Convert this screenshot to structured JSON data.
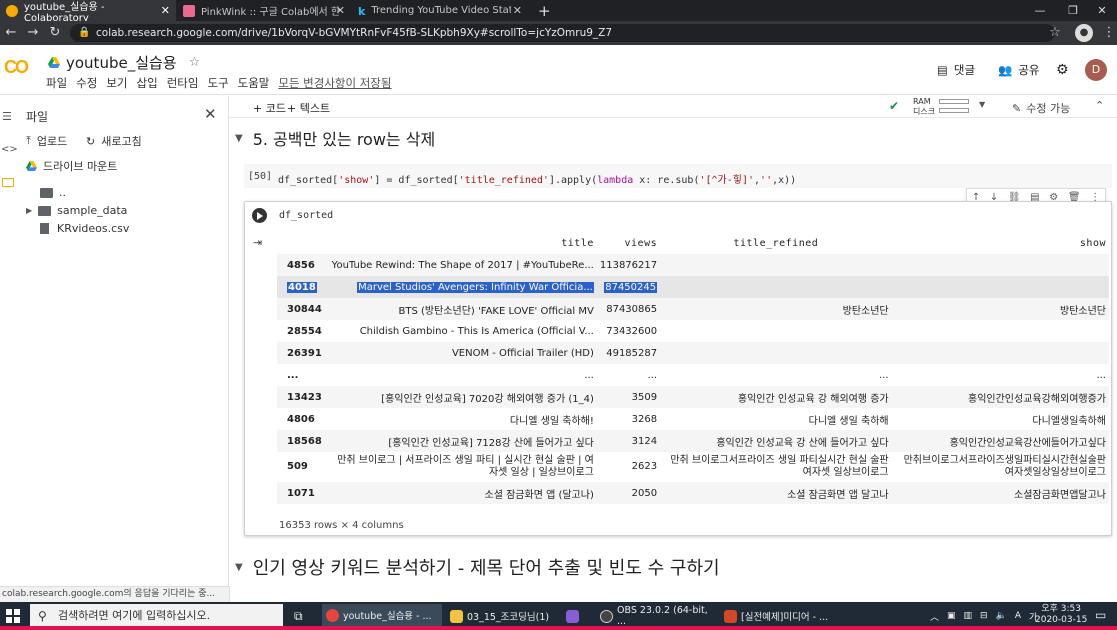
{
  "browser": {
    "tabs": [
      {
        "title": "youtube_실습용 - Colaboratory",
        "fav_color": "#f9ab00"
      },
      {
        "title": "PinkWink :: 구글 Colab에서 한글",
        "fav_color": "#e96a8d"
      },
      {
        "title": "Trending YouTube Video Statis",
        "fav_color": "#20beff"
      }
    ],
    "new_tab": "+",
    "url": "colab.research.google.com/drive/1bVorqV-bGVMYtRnFvF45fB-SLKpbh9Xy#scrollTo=jcYzOmru9_Z7"
  },
  "colab": {
    "logo": "CO",
    "title": "youtube_실습용",
    "menus": [
      "파일",
      "수정",
      "보기",
      "삽입",
      "런타임",
      "도구",
      "도움말"
    ],
    "saved_status": "모든 변경사항이 저장됨",
    "comment_label": "댓글",
    "share_label": "공유",
    "avatar_letter": "D",
    "add_code": "+ 코드",
    "add_text": "+ 텍스트",
    "ram_label": "RAM",
    "disk_label": "디스크",
    "edit_mode": "수정 가능"
  },
  "files": {
    "panel_title": "파일",
    "upload": "업로드",
    "refresh": "새로고침",
    "mount_drive": "드라이브 마운트",
    "items": [
      {
        "name": "..",
        "type": "folder"
      },
      {
        "name": "sample_data",
        "type": "folder"
      },
      {
        "name": "KRvideos.csv",
        "type": "file"
      }
    ]
  },
  "notebook": {
    "section1": "5. 공백만 있는 row는 삭제",
    "cell_number": "[50]",
    "code_output_expr": "df_sorted",
    "section2": "인기 영상 키워드 분석하기 - 제목 단어 추출 및 빈도 수 구하기"
  },
  "table": {
    "columns": [
      "",
      "title",
      "views",
      "title_refined",
      "show"
    ],
    "rows": [
      {
        "idx": "4856",
        "title": "YouTube Rewind: The Shape of 2017 | #YouTubeRe...",
        "views": "113876217",
        "refined": "",
        "show": ""
      },
      {
        "idx": "4018",
        "title": "Marvel Studios' Avengers: Infinity War Officia...",
        "views": "87450245",
        "refined": "",
        "show": ""
      },
      {
        "idx": "30844",
        "title": "BTS (방탄소년단) 'FAKE LOVE' Official MV",
        "views": "87430865",
        "refined": "방탄소년단",
        "show": "방탄소년단"
      },
      {
        "idx": "28554",
        "title": "Childish Gambino - This Is America (Official V...",
        "views": "73432600",
        "refined": "",
        "show": ""
      },
      {
        "idx": "26391",
        "title": "VENOM - Official Trailer (HD)",
        "views": "49185287",
        "refined": "",
        "show": ""
      },
      {
        "idx": "...",
        "title": "...",
        "views": "...",
        "refined": "...",
        "show": "..."
      },
      {
        "idx": "13423",
        "title": "[홍익인간 인성교육] 7020강 해외여행 증가 (1_4)",
        "views": "3509",
        "refined": "홍익인간 인성교육 강 해외여행 증가",
        "show": "홍익인간인성교육강해외여행증가"
      },
      {
        "idx": "4806",
        "title": "다니엘 생일 축하해!",
        "views": "3268",
        "refined": "다니엘 생일 축하해",
        "show": "다니엘생일축하해"
      },
      {
        "idx": "18568",
        "title": "[홍익인간 인성교육] 7128강 산에 들어가고 싶다",
        "views": "3124",
        "refined": "홍익인간 인성교육 강 산에 들어가고 싶다",
        "show": "홍익인간인성교육강산에들어가고싶다"
      },
      {
        "idx": "509",
        "title": "만취 브이로그 | 서프라이즈 생일 파티 | 실시간 현실 술판 | 여자셋 일상 | 일상브이로그",
        "views": "2623",
        "refined": "만취 브이로그서프라이즈 생일 파티실시간 현실 술판여자셋 일상브이로그",
        "show": "만취브이로그서프라이즈생일파티실시간현실술판여자셋일상일상브이로그"
      },
      {
        "idx": "1071",
        "title": "소셜 잠금화면 앱 (달고나)",
        "views": "2050",
        "refined": "소셜 잠금화면 앱 달고나",
        "show": "소셜잠금화면앱달고나"
      }
    ],
    "row_count": "16353 rows × 4 columns"
  },
  "status_bar": "colab.research.google.com의 응답을 기다리는 중...",
  "taskbar": {
    "search_placeholder": "검색하려면 여기에 입력하십시오.",
    "apps": [
      {
        "label": "youtube_실습용 - ...",
        "color": "#e8453c"
      },
      {
        "label": "03_15_조코딩님(1)",
        "color": "#f4c242"
      },
      {
        "label": "",
        "color": "#8a5cd6"
      },
      {
        "label": "OBS 23.0.2 (64-bit, ...",
        "color": "#444444"
      },
      {
        "label": "[실전예제]미디어 - ...",
        "color": "#d24726"
      }
    ],
    "time": "오후 3:53",
    "date": "2020-03-15"
  }
}
